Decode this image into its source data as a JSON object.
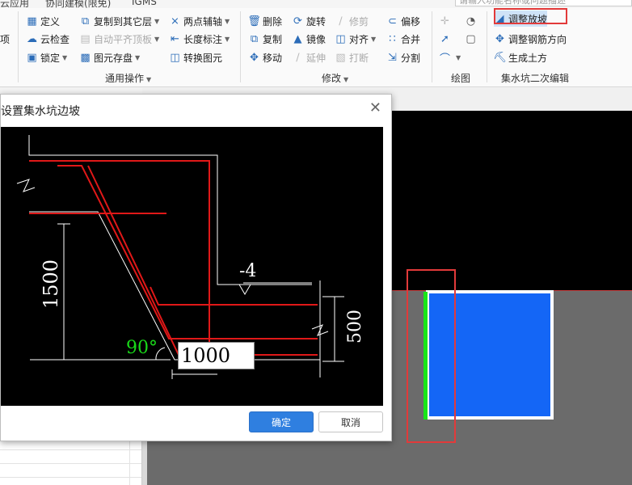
{
  "menu": {
    "items": [
      "云应用",
      "协同建模(限免)",
      "IGMS"
    ],
    "search_placeholder": "请输入功能名称或问题描述"
  },
  "ribbon": {
    "cut_left_label": "项",
    "general": {
      "col1": [
        "定义",
        "云检查",
        "锁定"
      ],
      "col2": [
        "复制到其它层",
        "自动平齐顶板",
        "图元存盘"
      ],
      "col3": [
        "两点辅轴",
        "长度标注",
        "转换图元"
      ],
      "group_label": "通用操作"
    },
    "modify": {
      "col1": [
        "删除",
        "复制",
        "移动"
      ],
      "col2": [
        "旋转",
        "镜像",
        "延伸"
      ],
      "col3": [
        "修剪",
        "对齐",
        "打断"
      ],
      "col4": [
        "偏移",
        "合并",
        "分割"
      ],
      "group_label": "修改"
    },
    "draw": {
      "group_label": "绘图"
    },
    "pit_edit": {
      "items": [
        "调整放坡",
        "调整钢筋方向",
        "生成土方"
      ],
      "group_label": "集水坑二次编辑"
    }
  },
  "dialog": {
    "title": "设置集水坑边坡",
    "diagram": {
      "dim_height": "1500",
      "dim_right": "500",
      "angle": "90°",
      "elevation": "-4"
    },
    "width_value": "1000",
    "ok_label": "确定",
    "cancel_label": "取消"
  },
  "colors": {
    "accent": "#2f7fe0",
    "highlight": "#e23a3a",
    "pit_fill": "#1466f6",
    "pit_edge": "#19e619"
  }
}
